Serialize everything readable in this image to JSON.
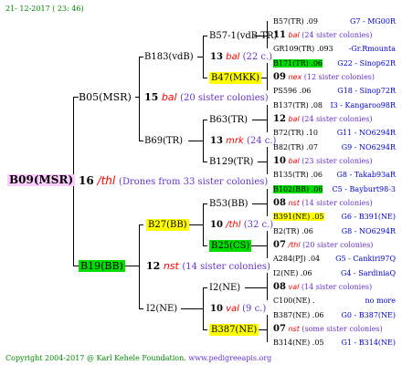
{
  "header": {
    "date": "21- 12-2017 ( 23: 46)"
  },
  "footer": {
    "copyright": "Copyright 2004-2017 @ Karl Kehele Foundation.",
    "website": "www.pedigreeapis.org"
  },
  "root": {
    "name": "B09(MSR)",
    "gen": "16",
    "mark": "/thl",
    "note": "(Drones from 33 sister colonies)"
  },
  "b05": {
    "name": "B05(MSR)",
    "gen": "15",
    "mark": "bal",
    "note": "(20 sister colonies)"
  },
  "b183": {
    "name": "B183(vdB)",
    "gen": "13",
    "mark": "bal",
    "note": "(22 c.)"
  },
  "b69": {
    "name": "B69(TR)",
    "gen": "13",
    "mark": "mrk",
    "note": "(24 c.)"
  },
  "b19": {
    "name": "B19(BB)",
    "gen": "12",
    "mark": "nst",
    "note": "(14 sister colonies)"
  },
  "b27": {
    "name": "B27(BB)",
    "gen": "10",
    "mark": "/thl",
    "note": "(32 c.)"
  },
  "i2": {
    "name": "I2(NE)",
    "gen": "10",
    "mark": "val",
    "note": "(9 c.)"
  },
  "g3": [
    {
      "name": "B57-1(vdB-TR)"
    },
    {
      "name": "B47(MKK)"
    },
    {
      "name": "B63(TR)",
      "gen": "12",
      "mark": "bal",
      "note": "(24 sister colonies)"
    },
    {
      "name": "B129(TR)",
      "gen": "10",
      "mark": "bal",
      "note": "(23 sister colonies)"
    },
    {
      "name": "B53(BB)"
    },
    {
      "name": "B25(CS)"
    },
    {
      "name": "I2(NE)",
      "gen": "08",
      "mark": "val",
      "note": "(14 sister colonies)"
    },
    {
      "name": "B387(NE)"
    }
  ],
  "g4": [
    {
      "name": "B57(TR) .09",
      "code": "G7 - MG00R"
    },
    {
      "gen": "11",
      "mark": "bal",
      "note": "(24 sister colonies)"
    },
    {
      "name": "GR109(TR) .093",
      "code": "-Gr.Rmounta"
    },
    {
      "name": "B171(TR) .06",
      "code": "G22 - Sinop62R"
    },
    {
      "gen": "09",
      "mark": "nex",
      "note": "(12 sister colonies)"
    },
    {
      "name": "PS596 .06",
      "code": "G18 - Sinop72R"
    },
    {
      "name": "B137(TR) .08",
      "code": "I3 - Kangaroo98R"
    },
    {
      "name": "B72(TR) .10",
      "code": "G11 - NO6294R"
    },
    {
      "name": "B82(TR) .07",
      "code": "G9 - NO6294R"
    },
    {
      "name": "B135(TR) .06",
      "code": "G8 - Takab93aR"
    },
    {
      "name": "B102(BB) .06",
      "code": "C5 - Bayburt98-3"
    },
    {
      "gen": "08",
      "mark": "nst",
      "note": "(14 sister colonies)"
    },
    {
      "name": "B391(NE) .05",
      "code": "G6 - B391(NE)"
    },
    {
      "name": "B2(TR) .06",
      "code": "G8 - NO6294R"
    },
    {
      "gen": "07",
      "mark": "/thl",
      "note": "(20 sister colonies)"
    },
    {
      "name": "A284(PJ) .04",
      "code": "G5 - Cankiri97Q"
    },
    {
      "name": "I2(NE) .06",
      "code": "G4 - SardiniaQ"
    },
    {
      "name": "C100(NE) .",
      "code": "no more"
    },
    {
      "name": "B387(NE) .06",
      "code": "G0 - B387(NE)"
    },
    {
      "gen": "07",
      "mark": "nst",
      "note": "(some sister colonies)"
    },
    {
      "name": "B314(NE) .05",
      "code": "G1 - B314(NE)"
    }
  ]
}
